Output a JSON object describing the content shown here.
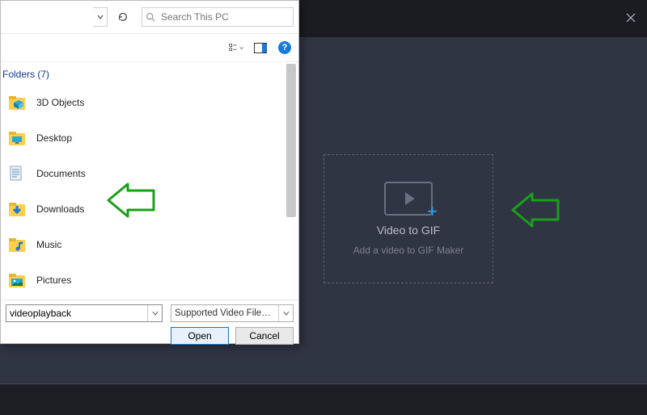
{
  "app": {
    "close_tooltip": "Close",
    "dropzone": {
      "title": "Video to GIF",
      "subtitle": "Add a video to GIF Maker",
      "plus_glyph": "+"
    }
  },
  "dialog": {
    "search_placeholder": "Search This PC",
    "folders_header": "Folders (7)",
    "items": [
      {
        "label": "3D Objects",
        "icon": "3dobjects"
      },
      {
        "label": "Desktop",
        "icon": "desktop"
      },
      {
        "label": "Documents",
        "icon": "documents"
      },
      {
        "label": "Downloads",
        "icon": "downloads"
      },
      {
        "label": "Music",
        "icon": "music"
      },
      {
        "label": "Pictures",
        "icon": "pictures"
      }
    ],
    "filename_value": "videoplayback",
    "filetype_label": "Supported Video Files (*.ts;*.mt",
    "open_label": "Open",
    "cancel_label": "Cancel"
  }
}
